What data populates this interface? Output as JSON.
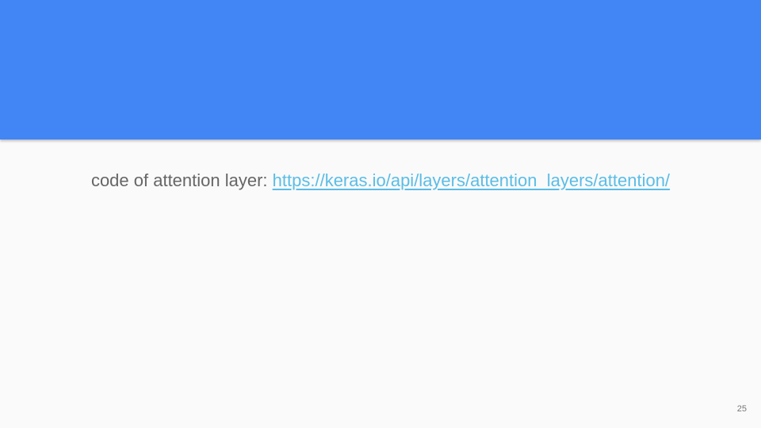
{
  "slide": {
    "prefix_text": "code of attention layer:",
    "link_text": "https://keras.io/api/layers/attention_layers/attention/",
    "page_number": "25"
  },
  "colors": {
    "header": "#4285f4",
    "background": "#fafafa",
    "text": "#666666",
    "link": "#5bbde6"
  }
}
